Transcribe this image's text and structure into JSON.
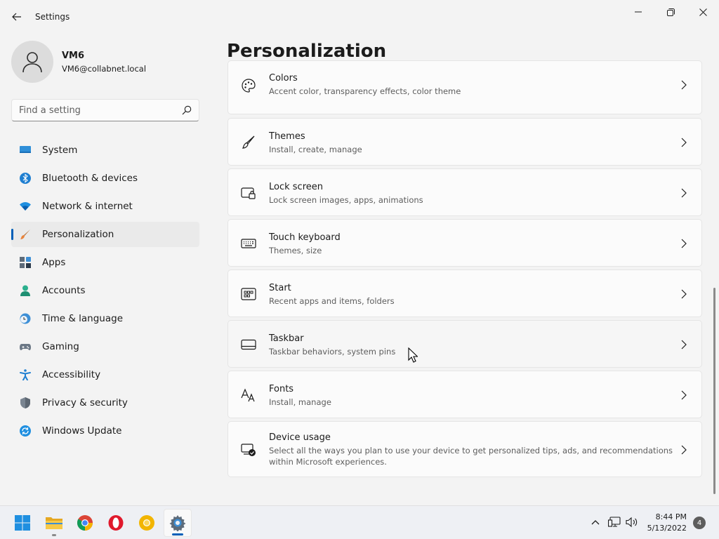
{
  "window": {
    "app_title": "Settings"
  },
  "profile": {
    "name": "VM6",
    "email": "VM6@collabnet.local"
  },
  "search": {
    "placeholder": "Find a setting"
  },
  "nav": {
    "selected": "Personalization",
    "items": [
      {
        "label": "System",
        "icon": "system-icon"
      },
      {
        "label": "Bluetooth & devices",
        "icon": "bluetooth-icon"
      },
      {
        "label": "Network & internet",
        "icon": "wifi-icon"
      },
      {
        "label": "Personalization",
        "icon": "brush-icon"
      },
      {
        "label": "Apps",
        "icon": "apps-icon"
      },
      {
        "label": "Accounts",
        "icon": "accounts-icon"
      },
      {
        "label": "Time & language",
        "icon": "clock-globe-icon"
      },
      {
        "label": "Gaming",
        "icon": "gamepad-icon"
      },
      {
        "label": "Accessibility",
        "icon": "accessibility-icon"
      },
      {
        "label": "Privacy & security",
        "icon": "shield-icon"
      },
      {
        "label": "Windows Update",
        "icon": "update-icon"
      }
    ]
  },
  "main": {
    "title": "Personalization",
    "cards": [
      {
        "title": "Colors",
        "subtitle": "Accent color, transparency effects, color theme",
        "icon": "palette-icon"
      },
      {
        "title": "Themes",
        "subtitle": "Install, create, manage",
        "icon": "brush-icon"
      },
      {
        "title": "Lock screen",
        "subtitle": "Lock screen images, apps, animations",
        "icon": "lock-screen-icon"
      },
      {
        "title": "Touch keyboard",
        "subtitle": "Themes, size",
        "icon": "keyboard-icon"
      },
      {
        "title": "Start",
        "subtitle": "Recent apps and items, folders",
        "icon": "start-icon"
      },
      {
        "title": "Taskbar",
        "subtitle": "Taskbar behaviors, system pins",
        "icon": "taskbar-icon"
      },
      {
        "title": "Fonts",
        "subtitle": "Install, manage",
        "icon": "fonts-icon"
      },
      {
        "title": "Device usage",
        "subtitle": "Select all the ways you plan to use your device to get personalized tips, ads, and recommendations within Microsoft experiences.",
        "icon": "device-usage-icon"
      }
    ]
  },
  "taskbar": {
    "apps": [
      "windows-start-icon",
      "file-explorer-icon",
      "chrome-icon",
      "opera-icon",
      "chrome-canary-icon",
      "settings-icon"
    ],
    "time": "8:44 PM",
    "date": "5/13/2022",
    "notification_count": "4"
  },
  "colors": {
    "accent": "#005fb8",
    "window_bg": "#f3f3f3",
    "card_bg": "#fbfbfb"
  }
}
